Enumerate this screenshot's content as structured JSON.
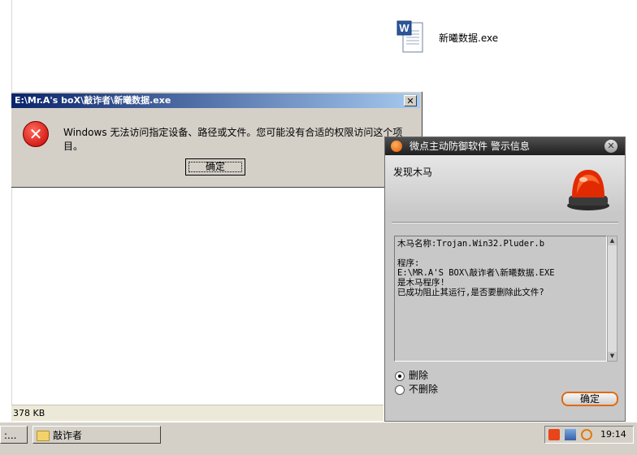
{
  "desktop": {
    "file_name": "新曦数据.exe"
  },
  "statusbar": {
    "size_text": "378 KB"
  },
  "taskbar": {
    "button1_label": ":...",
    "button2_label": "敲诈者",
    "clock": "19:14"
  },
  "error_dialog": {
    "title": "E:\\Mr.A's boX\\敲诈者\\新曦数据.exe",
    "close_glyph": "✕",
    "icon_glyph": "✕",
    "message": "Windows 无法访问指定设备、路径或文件。您可能没有合适的权限访问这个项目。",
    "ok_label": "确定"
  },
  "av_dialog": {
    "title": "微点主动防御软件   警示信息",
    "close_glyph": "✕",
    "heading": "发现木马",
    "details": [
      "木马名称:Trojan.Win32.Pluder.b",
      "",
      "程序:",
      "E:\\MR.A'S BOX\\敲诈者\\新曦数据.EXE",
      "是木马程序!",
      "已成功阻止其运行,是否要删除此文件?"
    ],
    "option_delete": "删除",
    "option_keep": "不删除",
    "ok_label": "确定",
    "accent_color": "#e06a10"
  }
}
